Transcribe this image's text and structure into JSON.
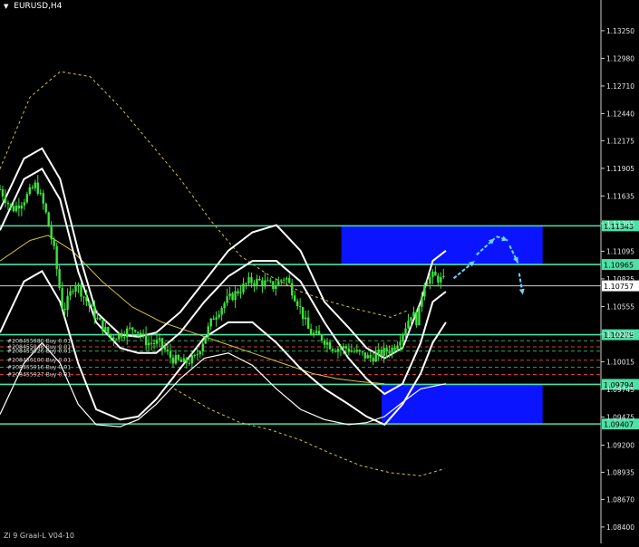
{
  "chart_data": {
    "type": "candlestick",
    "symbol": "EURUSD,H4",
    "footer": "Zi 9 Graal-L V04-10",
    "ylim": [
      1.0824,
      1.1355
    ],
    "y_ticks": [
      "1.13250",
      "1.12980",
      "1.12710",
      "1.12440",
      "1.12175",
      "1.11905",
      "1.11635",
      "1.11365",
      "1.11095",
      "1.10825",
      "1.10555",
      "1.10285",
      "1.10015",
      "1.09745",
      "1.09475",
      "1.09200",
      "1.08935",
      "1.08670",
      "1.08400"
    ],
    "levels": [
      {
        "label": "1.11343",
        "price": 1.11343,
        "style": "level"
      },
      {
        "label": "1.10965",
        "price": 1.10965,
        "style": "level"
      },
      {
        "label": "1.10757",
        "price": 1.10757,
        "style": "current"
      },
      {
        "label": "1.10279",
        "price": 1.10279,
        "style": "level"
      },
      {
        "label": "1.09794",
        "price": 1.09794,
        "style": "level"
      },
      {
        "label": "1.09407",
        "price": 1.09407,
        "style": "level"
      }
    ],
    "zones": [
      {
        "x_start": 0.568,
        "x_end": 0.903,
        "y_top": 1.11343,
        "y_bottom": 1.10965,
        "color": "#0a14ff"
      },
      {
        "x_start": 0.635,
        "x_end": 0.903,
        "y_top": 1.09794,
        "y_bottom": 1.09407,
        "color": "#0a14ff"
      }
    ],
    "order_labels": [
      "#208455980 Buy 0.01",
      "#208455948 Buy 0.01",
      "#208455926 Buy 0.01",
      "#208456100 Buy 0.01",
      "#208455916 Buy 0.01",
      "#208455927 Buy 0.01"
    ],
    "order_lines": [
      1.1022,
      1.1016,
      1.1012,
      1.1003,
      1.0996,
      1.0989
    ],
    "price_series": [
      [
        0.0,
        1.117
      ],
      [
        0.02,
        1.115
      ],
      [
        0.04,
        1.116
      ],
      [
        0.06,
        1.1175
      ],
      [
        0.075,
        1.115
      ],
      [
        0.09,
        1.111
      ],
      [
        0.105,
        1.105
      ],
      [
        0.125,
        1.108
      ],
      [
        0.145,
        1.106
      ],
      [
        0.165,
        1.104
      ],
      [
        0.185,
        1.1025
      ],
      [
        0.205,
        1.103
      ],
      [
        0.225,
        1.1035
      ],
      [
        0.245,
        1.102
      ],
      [
        0.265,
        1.102
      ],
      [
        0.285,
        1.1005
      ],
      [
        0.305,
        1.1
      ],
      [
        0.325,
        1.1005
      ],
      [
        0.34,
        1.1025
      ],
      [
        0.355,
        1.1045
      ],
      [
        0.375,
        1.106
      ],
      [
        0.395,
        1.107
      ],
      [
        0.415,
        1.108
      ],
      [
        0.435,
        1.108
      ],
      [
        0.455,
        1.1075
      ],
      [
        0.475,
        1.1085
      ],
      [
        0.495,
        1.106
      ],
      [
        0.515,
        1.103
      ],
      [
        0.535,
        1.1025
      ],
      [
        0.555,
        1.1015
      ],
      [
        0.575,
        1.1015
      ],
      [
        0.595,
        1.101
      ],
      [
        0.615,
        1.1005
      ],
      [
        0.635,
        1.101
      ],
      [
        0.655,
        1.1015
      ],
      [
        0.67,
        1.103
      ],
      [
        0.685,
        1.105
      ],
      [
        0.695,
        1.104
      ],
      [
        0.705,
        1.108
      ],
      [
        0.72,
        1.1085
      ],
      [
        0.74,
        1.108
      ]
    ],
    "dashed_yellow_ma": [
      [
        0.0,
        1.119
      ],
      [
        0.05,
        1.126
      ],
      [
        0.1,
        1.1285
      ],
      [
        0.15,
        1.128
      ],
      [
        0.2,
        1.125
      ],
      [
        0.25,
        1.1215
      ],
      [
        0.3,
        1.118
      ],
      [
        0.35,
        1.114
      ],
      [
        0.4,
        1.1105
      ],
      [
        0.45,
        1.1085
      ],
      [
        0.5,
        1.107
      ],
      [
        0.55,
        1.106
      ],
      [
        0.6,
        1.1052
      ],
      [
        0.65,
        1.1045
      ],
      [
        0.68,
        1.1052
      ]
    ],
    "dashed_yellow_low": [
      [
        0.29,
        1.0975
      ],
      [
        0.35,
        1.0955
      ],
      [
        0.4,
        1.0942
      ],
      [
        0.45,
        1.0935
      ],
      [
        0.5,
        1.0925
      ],
      [
        0.55,
        1.0912
      ],
      [
        0.6,
        1.09
      ],
      [
        0.65,
        1.0893
      ],
      [
        0.7,
        1.089
      ],
      [
        0.74,
        1.0897
      ]
    ],
    "solid_yellow_ma": [
      [
        0.0,
        1.11
      ],
      [
        0.05,
        1.112
      ],
      [
        0.08,
        1.1125
      ],
      [
        0.12,
        1.111
      ],
      [
        0.17,
        1.108
      ],
      [
        0.22,
        1.1055
      ],
      [
        0.27,
        1.104
      ],
      [
        0.32,
        1.103
      ],
      [
        0.37,
        1.102
      ],
      [
        0.42,
        1.101
      ],
      [
        0.47,
        1.1
      ],
      [
        0.52,
        1.099
      ],
      [
        0.56,
        1.0985
      ],
      [
        0.6,
        1.0982
      ],
      [
        0.64,
        1.098
      ]
    ],
    "white_upper": [
      [
        0.0,
        1.115
      ],
      [
        0.04,
        1.12
      ],
      [
        0.07,
        1.121
      ],
      [
        0.1,
        1.118
      ],
      [
        0.13,
        1.111
      ],
      [
        0.16,
        1.105
      ],
      [
        0.2,
        1.1028
      ],
      [
        0.23,
        1.1026
      ],
      [
        0.26,
        1.103
      ],
      [
        0.3,
        1.105
      ],
      [
        0.34,
        1.108
      ],
      [
        0.38,
        1.111
      ],
      [
        0.42,
        1.1128
      ],
      [
        0.46,
        1.1135
      ],
      [
        0.5,
        1.111
      ],
      [
        0.54,
        1.106
      ],
      [
        0.58,
        1.1035
      ],
      [
        0.61,
        1.1015
      ],
      [
        0.64,
        1.1005
      ],
      [
        0.67,
        1.1015
      ],
      [
        0.7,
        1.106
      ],
      [
        0.72,
        1.11
      ],
      [
        0.742,
        1.111
      ]
    ],
    "white_mid": [
      [
        0.0,
        1.113
      ],
      [
        0.04,
        1.118
      ],
      [
        0.07,
        1.119
      ],
      [
        0.1,
        1.116
      ],
      [
        0.13,
        1.109
      ],
      [
        0.16,
        1.104
      ],
      [
        0.2,
        1.1015
      ],
      [
        0.23,
        1.101
      ],
      [
        0.26,
        1.101
      ],
      [
        0.3,
        1.103
      ],
      [
        0.34,
        1.106
      ],
      [
        0.38,
        1.1085
      ],
      [
        0.42,
        1.11
      ],
      [
        0.46,
        1.11
      ],
      [
        0.5,
        1.108
      ],
      [
        0.54,
        1.104
      ],
      [
        0.58,
        1.1005
      ],
      [
        0.61,
        1.0985
      ],
      [
        0.64,
        1.097
      ],
      [
        0.67,
        1.098
      ],
      [
        0.7,
        1.102
      ],
      [
        0.72,
        1.106
      ],
      [
        0.742,
        1.107
      ]
    ],
    "white_lower": [
      [
        0.0,
        1.103
      ],
      [
        0.04,
        1.108
      ],
      [
        0.07,
        1.109
      ],
      [
        0.1,
        1.106
      ],
      [
        0.13,
        1.1
      ],
      [
        0.16,
        1.0955
      ],
      [
        0.2,
        1.0945
      ],
      [
        0.23,
        1.0948
      ],
      [
        0.26,
        1.0965
      ],
      [
        0.3,
        1.0995
      ],
      [
        0.34,
        1.1025
      ],
      [
        0.38,
        1.104
      ],
      [
        0.42,
        1.104
      ],
      [
        0.46,
        1.102
      ],
      [
        0.5,
        1.0995
      ],
      [
        0.54,
        1.0975
      ],
      [
        0.58,
        1.096
      ],
      [
        0.61,
        1.0948
      ],
      [
        0.64,
        1.094
      ],
      [
        0.67,
        1.096
      ],
      [
        0.7,
        1.099
      ],
      [
        0.72,
        1.102
      ],
      [
        0.742,
        1.104
      ]
    ],
    "white_outer": [
      [
        0.0,
        1.095
      ],
      [
        0.04,
        1.1
      ],
      [
        0.07,
        1.102
      ],
      [
        0.1,
        1.1
      ],
      [
        0.13,
        1.096
      ],
      [
        0.16,
        1.094
      ],
      [
        0.2,
        1.0938
      ],
      [
        0.23,
        1.0945
      ],
      [
        0.26,
        1.096
      ],
      [
        0.3,
        1.0985
      ],
      [
        0.34,
        1.1005
      ],
      [
        0.38,
        1.101
      ],
      [
        0.42,
        1.0998
      ],
      [
        0.46,
        1.0975
      ],
      [
        0.5,
        1.0955
      ],
      [
        0.54,
        1.0945
      ],
      [
        0.58,
        1.094
      ],
      [
        0.61,
        1.0942
      ],
      [
        0.64,
        1.0948
      ],
      [
        0.67,
        1.0962
      ],
      [
        0.7,
        1.0975
      ],
      [
        0.742,
        1.098
      ]
    ],
    "forecast_arrows": [
      [
        [
          0.755,
          1.1083
        ],
        [
          0.79,
          1.11
        ]
      ],
      [
        [
          0.793,
          1.1106
        ],
        [
          0.823,
          1.1122
        ]
      ],
      [
        [
          0.826,
          1.1124
        ],
        [
          0.845,
          1.112
        ]
      ],
      [
        [
          0.848,
          1.1115
        ],
        [
          0.862,
          1.1098
        ]
      ],
      [
        [
          0.864,
          1.1088
        ],
        [
          0.87,
          1.1067
        ]
      ]
    ],
    "colors": {
      "candles": "#3fe23f",
      "levels": "#4ee0a6",
      "zone": "#0a14ff",
      "bands": "#ffffff",
      "ma": "#d8c23a",
      "forecast": "#6bd5ff",
      "orders": "#d43a3a"
    }
  }
}
